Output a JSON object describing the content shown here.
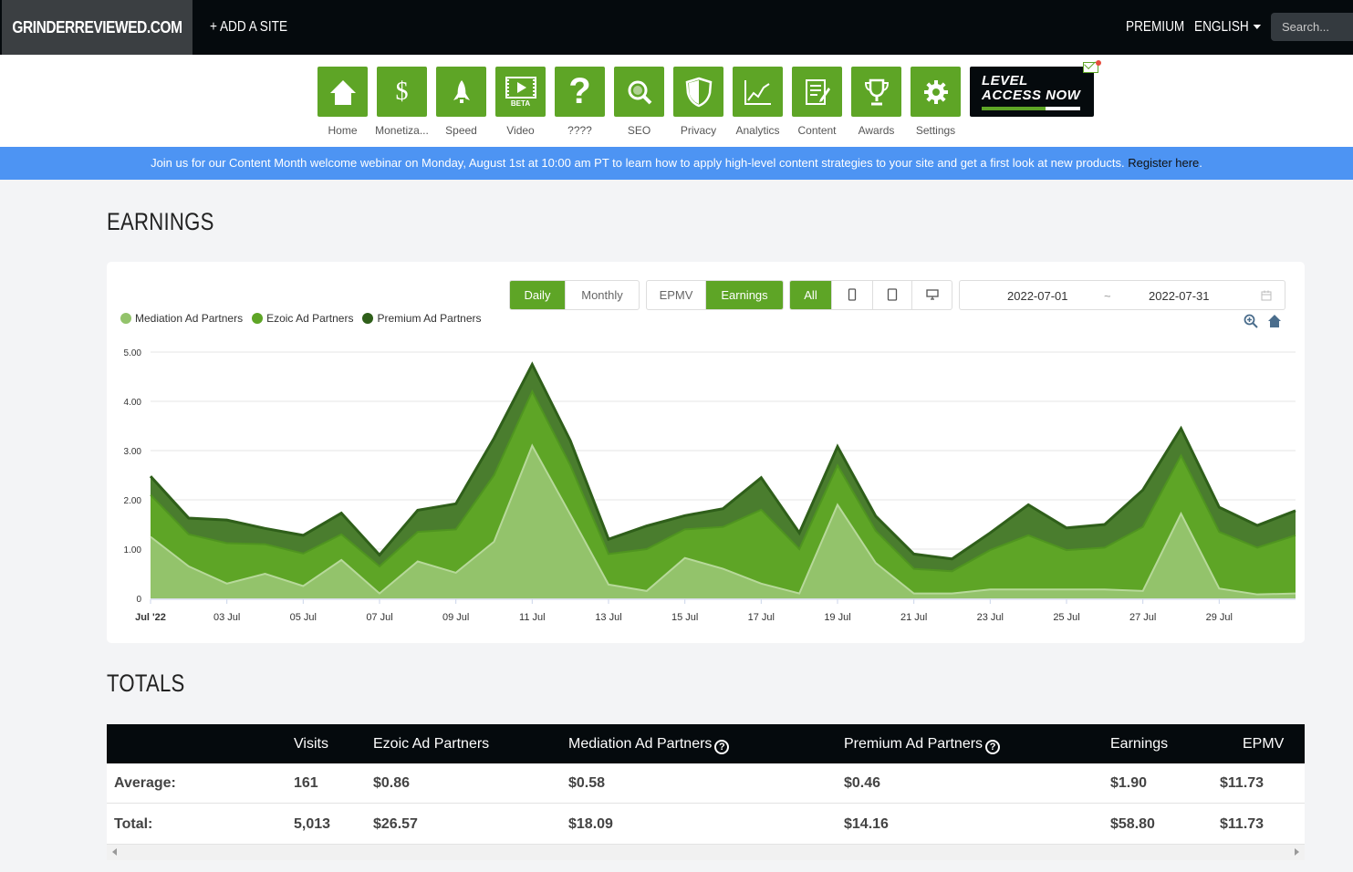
{
  "topbar": {
    "brand": "GRINDERREVIEWED.COM",
    "add_site": "+ ADD A SITE",
    "premium": "PREMIUM",
    "language": "ENGLISH",
    "search_placeholder": "Search..."
  },
  "nav": {
    "items": [
      {
        "label": "Home",
        "icon": "home-icon"
      },
      {
        "label": "Monetiza...",
        "icon": "dollar-icon"
      },
      {
        "label": "Speed",
        "icon": "rocket-icon"
      },
      {
        "label": "Video",
        "icon": "video-icon"
      },
      {
        "label": "????",
        "icon": "question-icon"
      },
      {
        "label": "SEO",
        "icon": "magnifier-icon"
      },
      {
        "label": "Privacy",
        "icon": "shield-icon"
      },
      {
        "label": "Analytics",
        "icon": "line-chart-icon"
      },
      {
        "label": "Content",
        "icon": "document-edit-icon"
      },
      {
        "label": "Awards",
        "icon": "trophy-icon"
      },
      {
        "label": "Settings",
        "icon": "gear-icon"
      }
    ],
    "video_badge": "BETA",
    "level_line1": "LEVEL",
    "level_line2": "ACCESS NOW",
    "level_progress": 0.65
  },
  "banner": {
    "text": "Join us for our Content Month welcome webinar on Monday, August 1st at 10:00 am PT to learn how to apply high-level content strategies to your site and get a first look at new products.",
    "link": "Register here",
    "link_suffix": "."
  },
  "earnings": {
    "title": "EARNINGS",
    "period_buttons": [
      "Daily",
      "Monthly"
    ],
    "metric_buttons": [
      "EPMV",
      "Earnings"
    ],
    "device_buttons": [
      "All"
    ],
    "device_icons": [
      "phone-icon",
      "tablet-icon",
      "desktop-icon"
    ],
    "date_start": "2022-07-01",
    "date_sep": "~",
    "date_end": "2022-07-31",
    "colors": {
      "mediation": "#93c36b",
      "ezoic": "#5ea526",
      "premium": "#4a7d2e",
      "premium_line": "#2f5f1a"
    }
  },
  "chart_data": {
    "type": "area",
    "stacked": true,
    "x": [
      "2022-07-01",
      "2022-07-02",
      "2022-07-03",
      "2022-07-04",
      "2022-07-05",
      "2022-07-06",
      "2022-07-07",
      "2022-07-08",
      "2022-07-09",
      "2022-07-10",
      "2022-07-11",
      "2022-07-12",
      "2022-07-13",
      "2022-07-14",
      "2022-07-15",
      "2022-07-16",
      "2022-07-17",
      "2022-07-18",
      "2022-07-19",
      "2022-07-20",
      "2022-07-21",
      "2022-07-22",
      "2022-07-23",
      "2022-07-24",
      "2022-07-25",
      "2022-07-26",
      "2022-07-27",
      "2022-07-28",
      "2022-07-29",
      "2022-07-30",
      "2022-07-31"
    ],
    "tick_labels": [
      "Jul '22",
      "03 Jul",
      "05 Jul",
      "07 Jul",
      "09 Jul",
      "11 Jul",
      "13 Jul",
      "15 Jul",
      "17 Jul",
      "19 Jul",
      "21 Jul",
      "23 Jul",
      "25 Jul",
      "27 Jul",
      "29 Jul"
    ],
    "y_ticks": [
      "0",
      "1.00",
      "2.00",
      "3.00",
      "4.00",
      "5.00"
    ],
    "ylim": [
      0,
      5
    ],
    "grid": true,
    "legend_position": "top-left",
    "series": [
      {
        "name": "Mediation Ad Partners",
        "values": [
          1.25,
          0.65,
          0.3,
          0.5,
          0.25,
          0.78,
          0.1,
          0.75,
          0.52,
          1.15,
          3.1,
          1.7,
          0.28,
          0.15,
          0.82,
          0.6,
          0.3,
          0.1,
          1.9,
          0.72,
          0.1,
          0.1,
          0.18,
          0.18,
          0.18,
          0.18,
          0.15,
          1.72,
          0.2,
          0.08,
          0.1
        ]
      },
      {
        "name": "Ezoic Ad Partners",
        "values": [
          0.85,
          0.65,
          0.82,
          0.6,
          0.66,
          0.52,
          0.55,
          0.6,
          0.88,
          1.35,
          1.1,
          1.0,
          0.62,
          0.85,
          0.58,
          0.85,
          1.5,
          0.9,
          0.8,
          0.65,
          0.5,
          0.45,
          0.8,
          1.1,
          0.8,
          0.85,
          1.3,
          1.18,
          1.15,
          0.95,
          1.18
        ]
      },
      {
        "name": "Premium Ad Partners",
        "values": [
          0.38,
          0.33,
          0.47,
          0.32,
          0.37,
          0.43,
          0.23,
          0.44,
          0.52,
          0.75,
          0.55,
          0.5,
          0.3,
          0.47,
          0.28,
          0.37,
          0.65,
          0.33,
          0.38,
          0.3,
          0.3,
          0.25,
          0.35,
          0.62,
          0.45,
          0.47,
          0.75,
          0.55,
          0.5,
          0.45,
          0.5
        ]
      }
    ]
  },
  "totals": {
    "title": "TOTALS",
    "headers": [
      "Visits",
      "Ezoic Ad Partners",
      "Mediation Ad Partners",
      "Premium Ad Partners",
      "Earnings",
      "EPMV"
    ],
    "rows": [
      {
        "label": "Average:",
        "visits": "161",
        "ezoic": "$0.86",
        "mediation": "$0.58",
        "premium": "$0.46",
        "earnings": "$1.90",
        "epmv": "$11.73"
      },
      {
        "label": "Total:",
        "visits": "5,013",
        "ezoic": "$26.57",
        "mediation": "$18.09",
        "premium": "$14.16",
        "earnings": "$58.80",
        "epmv": "$11.73"
      }
    ]
  }
}
